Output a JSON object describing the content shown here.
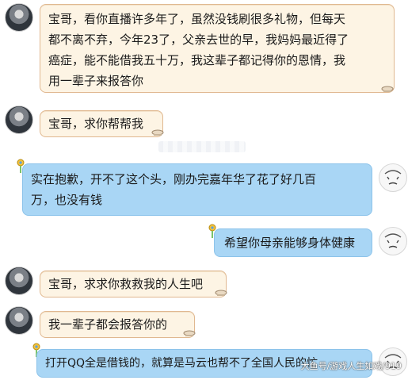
{
  "messages": [
    {
      "side": "left",
      "text": "宝哥，看你直播许多年了，虽然没钱刷很多礼物，但每天\n都不离不弃，今年23了，父亲去世的早，我妈妈最近得了\n癌症，能不能借我五十万，我这辈子都记得你的恩情，我\n用一辈子来报答你"
    },
    {
      "side": "left",
      "text": "宝哥，求你帮帮我"
    },
    {
      "side": "right",
      "text": "实在抱歉，开不了这个头，刚办完嘉年华了花了好几百\n万，也没有钱"
    },
    {
      "side": "right",
      "text": "希望你母亲能够身体健康"
    },
    {
      "side": "left",
      "text": "宝哥，求求你救救我的人生吧"
    },
    {
      "side": "left",
      "text": "我一辈子都会报答你的"
    },
    {
      "side": "right",
      "text": "打开QQ全是借钱的，就算是马云也帮不了全国人民的忙"
    }
  ],
  "watermark": "大鱼号/游戏人生如戏/919",
  "colors": {
    "incoming_bg": "#fdf4e4",
    "incoming_border": "#e0b890",
    "outgoing_bg": "#a9d6f5",
    "outgoing_border": "#8cc3ea"
  },
  "icons": {
    "incoming_decor": "teacup-icon",
    "outgoing_decor": "pin-icon",
    "sender_avatar": "avatar",
    "streamer_avatar": "avatar"
  }
}
